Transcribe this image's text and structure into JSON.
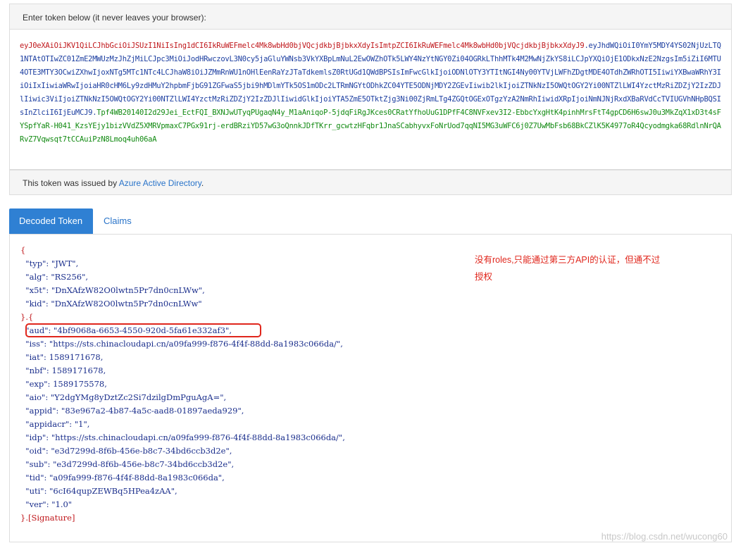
{
  "input_header": "Enter token below (it never leaves your browser):",
  "token": {
    "header_part": "eyJ0eXAiOiJKV1QiLCJhbGciOiJSUzI1NiIsIng1dCI6IkRuWEFmelc4Mk8wbHd0bjVQcjdkbjBjbkxXdyIsImtpZCI6IkRuWEFmelc4Mk8wbHd0bjVQcjdkbjBjbkxXdyJ9",
    "payload_part": "eyJhdWQiOiI0YmY5MDY4YS02NjUzLTQ1NTAtOTIwZC01ZmE2MWUzMzJhZjMiLCJpc3MiOiJodHRwczovL3N0cy5jaGluYWNsb3VkYXBpLmNuL2EwOWZhOTk5LWY4NzYtNGY0Zi04OGRkLThhMTk4M2MwNjZkYS8iLCJpYXQiOjE1ODkxNzE2NzgsIm5iZiI6MTU4OTE3MTY3OCwiZXhwIjoxNTg5MTc1NTc4LCJhaW8iOiJZMmRnWU1nOHlEenRaYzJTaTdkemlsZ0RtUGd1QWdBPSIsImFwcGlkIjoiODNlOTY3YTItNGI4Ny00YTVjLWFhZDgtMDE4OTdhZWRhOTI5IiwiYXBwaWRhY3IiOiIxIiwiaWRwIjoiaHR0cHM6Ly9zdHMuY2hpbmFjbG91ZGFwaS5jbi9hMDlmYTk5OS1mODc2LTRmNGYtODhkZC04YTE5ODNjMDY2ZGEvIiwib2lkIjoiZTNkNzI5OWQtOGY2Yi00NTZlLWI4YzctMzRiZDZjY2IzZDJlIiwic3ViIjoiZTNkNzI5OWQtOGY2Yi00NTZlLWI4YzctMzRiZDZjY2IzZDJlIiwidGlkIjoiYTA5ZmE5OTktZjg3Ni00ZjRmLTg4ZGQtOGExOTgzYzA2NmRhIiwidXRpIjoiNmNJNjRxdXBaRVdCcTVIUGVhNHpBQSIsInZlciI6IjEuMCJ9",
    "signature_part": "Tpf4WB20140I2d29Jei_EctFQI_BXNJwUTyqPUgaqN4y_M1aAniqoP-5jdqFiRgJKces0CRatYfhoUuG1DPfF4C8NVFxev3I2-EbbcYxgHtK4pinhMrsFtT4gpCD6H6swJ0u3MkZqX1xD3t4sFYSpfYaR-H041_KzsYEjy1bizVVdZ5XMRVpmaxC7PGx91rj-erdBRziYD57wG3oQnnkJDfTKrr_gcwtzHFqbr1JnaSCabhyvxFoNrUod7qqNI5MG3uWFC6j0Z7UwMbFsb68BkCZlK5K4977oR4Qcyodmgka68RdlnNrQARvZ7Vqwsqt7tCCAuiPzN8Lmoq4uh06aA"
  },
  "issued": {
    "prefix": "This token was issued by ",
    "link": "Azure Active Directory",
    "suffix": "."
  },
  "tabs": {
    "decoded": "Decoded Token",
    "claims": "Claims"
  },
  "decoded_lines": [
    "{",
    "  \"typ\": \"JWT\",",
    "  \"alg\": \"RS256\",",
    "  \"x5t\": \"DnXAfzW82O0lwtn5Pr7dn0cnLWw\",",
    "  \"kid\": \"DnXAfzW82O0lwtn5Pr7dn0cnLWw\"",
    "}.{",
    "  \"aud\": \"4bf9068a-6653-4550-920d-5fa61e332af3\",",
    "  \"iss\": \"https://sts.chinacloudapi.cn/a09fa999-f876-4f4f-88dd-8a1983c066da/\",",
    "  \"iat\": 1589171678,",
    "  \"nbf\": 1589171678,",
    "  \"exp\": 1589175578,",
    "  \"aio\": \"Y2dgYMg8yDztZc2Si7dzilgDmPguAgA=\",",
    "  \"appid\": \"83e967a2-4b87-4a5c-aad8-01897aeda929\",",
    "  \"appidacr\": \"1\",",
    "  \"idp\": \"https://sts.chinacloudapi.cn/a09fa999-f876-4f4f-88dd-8a1983c066da/\",",
    "  \"oid\": \"e3d7299d-8f6b-456e-b8c7-34bd6ccb3d2e\",",
    "  \"sub\": \"e3d7299d-8f6b-456e-b8c7-34bd6ccb3d2e\",",
    "  \"tid\": \"a09fa999-f876-4f4f-88dd-8a1983c066da\",",
    "  \"uti\": \"6cI64qupZEWBq5HPea4zAA\",",
    "  \"ver\": \"1.0\"",
    "}.[Signature]"
  ],
  "annotation": "没有roles,只能通过第三方API的认证，但通不过授权",
  "watermark": "https://blog.csdn.net/wucong60",
  "colors": {
    "header": "#c0181c",
    "payload": "#1c3ea0",
    "signature": "#128a12",
    "accent": "#2f80d3",
    "annotation": "#e0261c"
  }
}
